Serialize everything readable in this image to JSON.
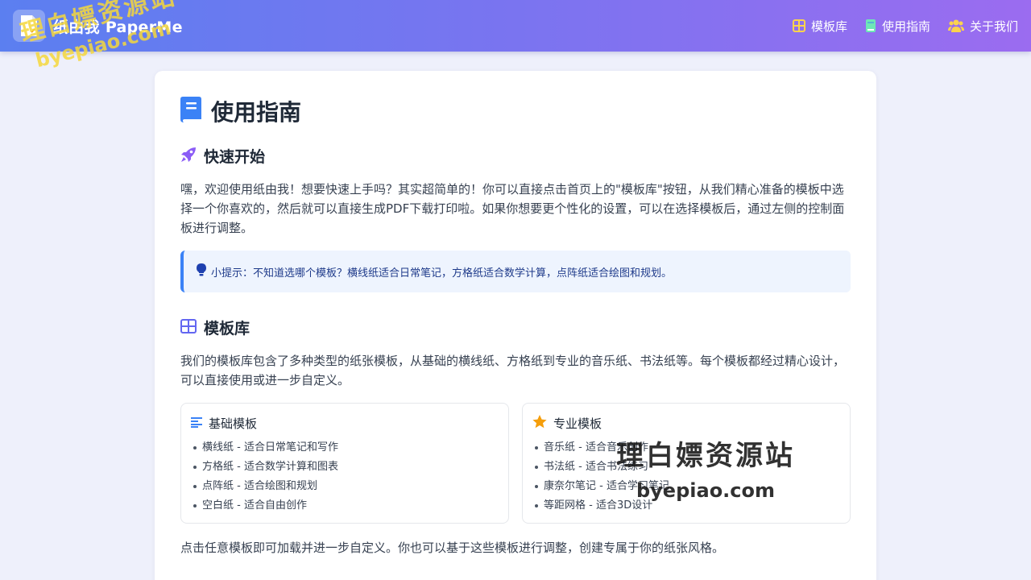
{
  "header": {
    "title": "纸由我 PaperMe",
    "logo_icon": "document-icon",
    "nav": [
      {
        "label": "模板库",
        "icon": "grid-icon",
        "color": "#fcd34d"
      },
      {
        "label": "使用指南",
        "icon": "book-icon",
        "color": "#6ee7b7"
      },
      {
        "label": "关于我们",
        "icon": "users-icon",
        "color": "#fcd34d"
      }
    ]
  },
  "main": {
    "title": "使用指南",
    "quick_start": {
      "heading": "快速开始",
      "text": "嘿，欢迎使用纸由我！想要快速上手吗？其实超简单的！你可以直接点击首页上的\"模板库\"按钮，从我们精心准备的模板中选择一个你喜欢的，然后就可以直接生成PDF下载打印啦。如果你想要更个性化的设置，可以在选择模板后，通过左侧的控制面板进行调整。",
      "tip": "小提示：不知道选哪个模板？横线纸适合日常笔记，方格纸适合数学计算，点阵纸适合绘图和规划。"
    },
    "library": {
      "heading": "模板库",
      "text": "我们的模板库包含了多种类型的纸张模板，从基础的横线纸、方格纸到专业的音乐纸、书法纸等。每个模板都经过精心设计，可以直接使用或进一步自定义。",
      "basic": {
        "title": "基础模板",
        "items": [
          "横线纸 - 适合日常笔记和写作",
          "方格纸 - 适合数学计算和图表",
          "点阵纸 - 适合绘图和规划",
          "空白纸 - 适合自由创作"
        ]
      },
      "pro": {
        "title": "专业模板",
        "items": [
          "音乐纸 - 适合音乐创作",
          "书法纸 - 适合书法练习",
          "康奈尔笔记 - 适合学习笔记",
          "等距网格 - 适合3D设计"
        ]
      },
      "footer": "点击任意模板即可加载并进一步自定义。你也可以基于这些模板进行调整，创建专属于你的纸张风格。"
    }
  },
  "watermarks": {
    "top_left": {
      "line1": "理白嫖资源站",
      "line2": "byepiao.com"
    },
    "bottom_right": {
      "line1": "理白嫖资源站",
      "line2": "byepiao.com"
    }
  },
  "colors": {
    "accent": "#3b82f6",
    "rocket": "#8b5cf6",
    "grid": "#6366f1",
    "star": "#f59e0b"
  }
}
